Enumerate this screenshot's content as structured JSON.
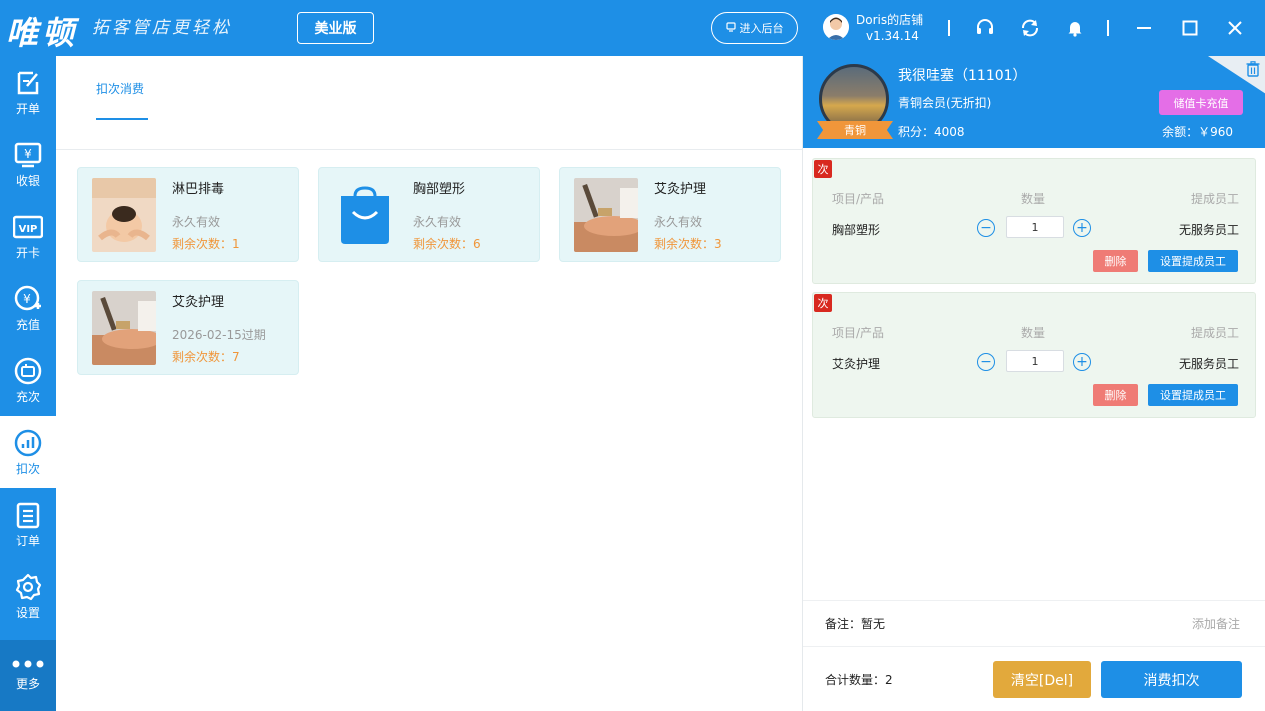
{
  "brand": {
    "logo": "唯顿",
    "slogan": "拓客管店更轻松",
    "edition": "美业版"
  },
  "header": {
    "backend_button": "进入后台",
    "store_name": "Doris的店铺",
    "version": "v1.34.14"
  },
  "sidebar": {
    "items": [
      {
        "label": "开单",
        "icon": "new-order-icon"
      },
      {
        "label": "收银",
        "icon": "cashier-icon"
      },
      {
        "label": "开卡",
        "icon": "vip-card-icon"
      },
      {
        "label": "充值",
        "icon": "recharge-icon"
      },
      {
        "label": "充次",
        "icon": "recharge-times-icon"
      },
      {
        "label": "扣次",
        "icon": "deduct-times-icon",
        "active": true
      },
      {
        "label": "订单",
        "icon": "order-icon"
      },
      {
        "label": "设置",
        "icon": "gear-icon"
      }
    ],
    "more_label": "更多"
  },
  "main": {
    "tab_label": "扣次消费",
    "cards": [
      {
        "title": "淋巴排毒",
        "validity": "永久有效",
        "remain": "剩余次数：1",
        "thumb": "massage-photo"
      },
      {
        "title": "胸部塑形",
        "validity": "永久有效",
        "remain": "剩余次数：6",
        "thumb": "shopping-bag-icon"
      },
      {
        "title": "艾灸护理",
        "validity": "永久有效",
        "remain": "剩余次数：3",
        "thumb": "moxibustion-photo"
      },
      {
        "title": "艾灸护理",
        "validity": "2026-02-15过期",
        "remain": "剩余次数：7",
        "thumb": "moxibustion-photo"
      }
    ]
  },
  "member": {
    "name": "我很哇塞（11101）",
    "level": "青铜会员(无折扣)",
    "level_badge": "青铜",
    "points": "积分：4008",
    "recharge_button": "储值卡充值",
    "balance": "余额：￥960"
  },
  "orders": {
    "badge": "次",
    "header_item": "项目/产品",
    "header_qty": "数量",
    "header_staff": "提成员工",
    "delete_label": "删除",
    "set_staff_label": "设置提成员工",
    "items": [
      {
        "name": "胸部塑形",
        "qty": "1",
        "staff": "无服务员工"
      },
      {
        "name": "艾灸护理",
        "qty": "1",
        "staff": "无服务员工"
      }
    ]
  },
  "remark": {
    "label": "备注：暂无",
    "add_label": "添加备注"
  },
  "footer": {
    "total": "合计数量：2",
    "clear_button": "清空[Del]",
    "consume_button": "消费扣次"
  },
  "colors": {
    "primary": "#1e8fe6",
    "orange": "#f0963a",
    "danger": "#d8291f",
    "pink": "#e46ee7",
    "gold": "#e2a93c"
  }
}
